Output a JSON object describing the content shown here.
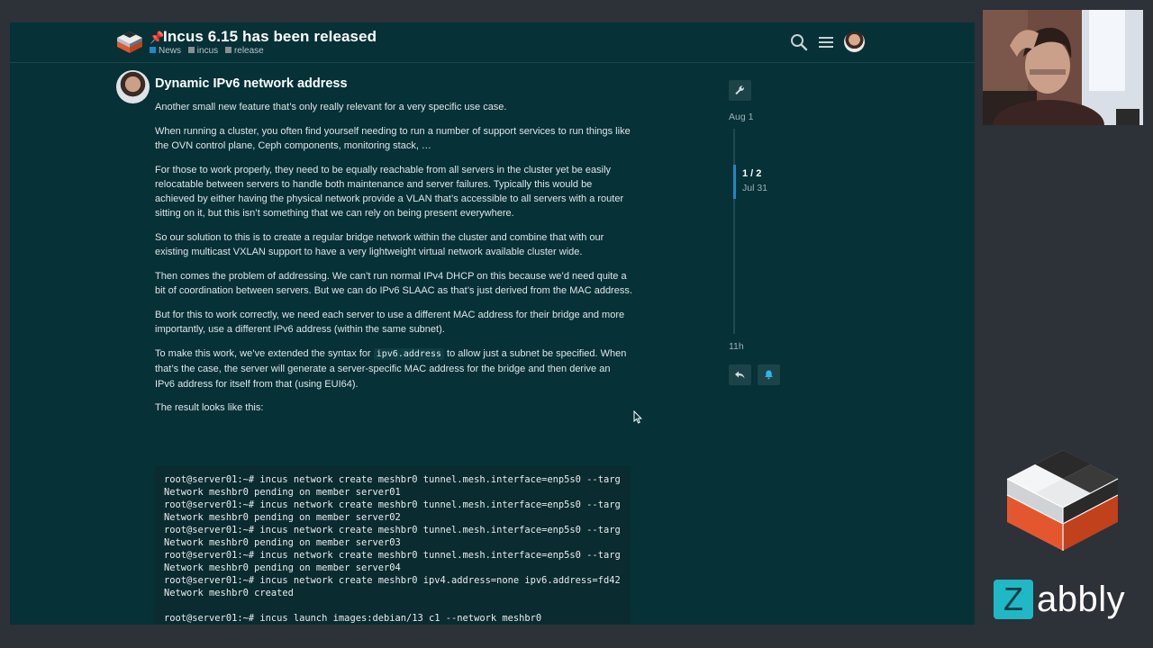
{
  "header": {
    "pin": "📌",
    "title": "Incus 6.15 has been released",
    "tags": [
      {
        "label": "News",
        "color": "#1e88c7"
      },
      {
        "label": "incus",
        "color": "#8a8f94"
      },
      {
        "label": "release",
        "color": "#8a8f94"
      }
    ]
  },
  "post": {
    "heading": "Dynamic IPv6 network address",
    "paragraphs": {
      "p1": "Another small new feature that’s only really relevant for a very specific use case.",
      "p2": "When running a cluster, you often find yourself needing to run a number of support services to run things like the OVN control plane, Ceph components, monitoring stack, …",
      "p3": "For those to work properly, they need to be equally reachable from all servers in the cluster yet be easily relocatable between servers to handle both maintenance and server failures. Typically this would be achieved by either having the physical network provide a VLAN that’s accessible to all servers with a router sitting on it, but this isn’t something that we can rely on being present everywhere.",
      "p4": "So our solution to this is to create a regular bridge network within the cluster and combine that with our existing multicast VXLAN support to have a very lightweight virtual network available cluster wide.",
      "p5": "Then comes the problem of addressing. We can’t run normal IPv4 DHCP on this because we’d need quite a bit of coordination between servers. But we can do IPv6 SLAAC as that’s just derived from the MAC address.",
      "p6": "But for this to work correctly, we need each server to use a different MAC address for their bridge and more importantly, use a different IPv6 address (within the same subnet).",
      "p7a": "To make this work, we’ve extended the syntax for ",
      "p7code": "ipv6.address",
      "p7b": " to allow just a subnet be specified. When that’s the case, the server will generate a server-specific MAC address for the bridge and then derive an IPv6 address for itself from that (using EUI64).",
      "p8": "The result looks like this:"
    },
    "code_lines": [
      "root@server01:~# incus network create meshbr0 tunnel.mesh.interface=enp5s0 --targ",
      "Network meshbr0 pending on member server01",
      "root@server01:~# incus network create meshbr0 tunnel.mesh.interface=enp5s0 --targ",
      "Network meshbr0 pending on member server02",
      "root@server01:~# incus network create meshbr0 tunnel.mesh.interface=enp5s0 --targ",
      "Network meshbr0 pending on member server03",
      "root@server01:~# incus network create meshbr0 tunnel.mesh.interface=enp5s0 --targ",
      "Network meshbr0 pending on member server04",
      "root@server01:~# incus network create meshbr0 ipv4.address=none ipv6.address=fd42",
      "Network meshbr0 created",
      "",
      "root@server01:~# incus launch images:debian/13 c1 --network meshbr0"
    ]
  },
  "timeline": {
    "start_label": "Aug 1",
    "position": "1 / 2",
    "position_date": "Jul 31",
    "end_label": "11h"
  },
  "branding": {
    "badge_letter": "Z",
    "wordmark": "abbly",
    "badge_color": "#1fb8c4"
  },
  "icons": {
    "search": "search-icon",
    "menu": "hamburger-menu-icon",
    "wrench": "wrench-icon",
    "reply": "reply-icon",
    "bell": "bell-icon"
  }
}
